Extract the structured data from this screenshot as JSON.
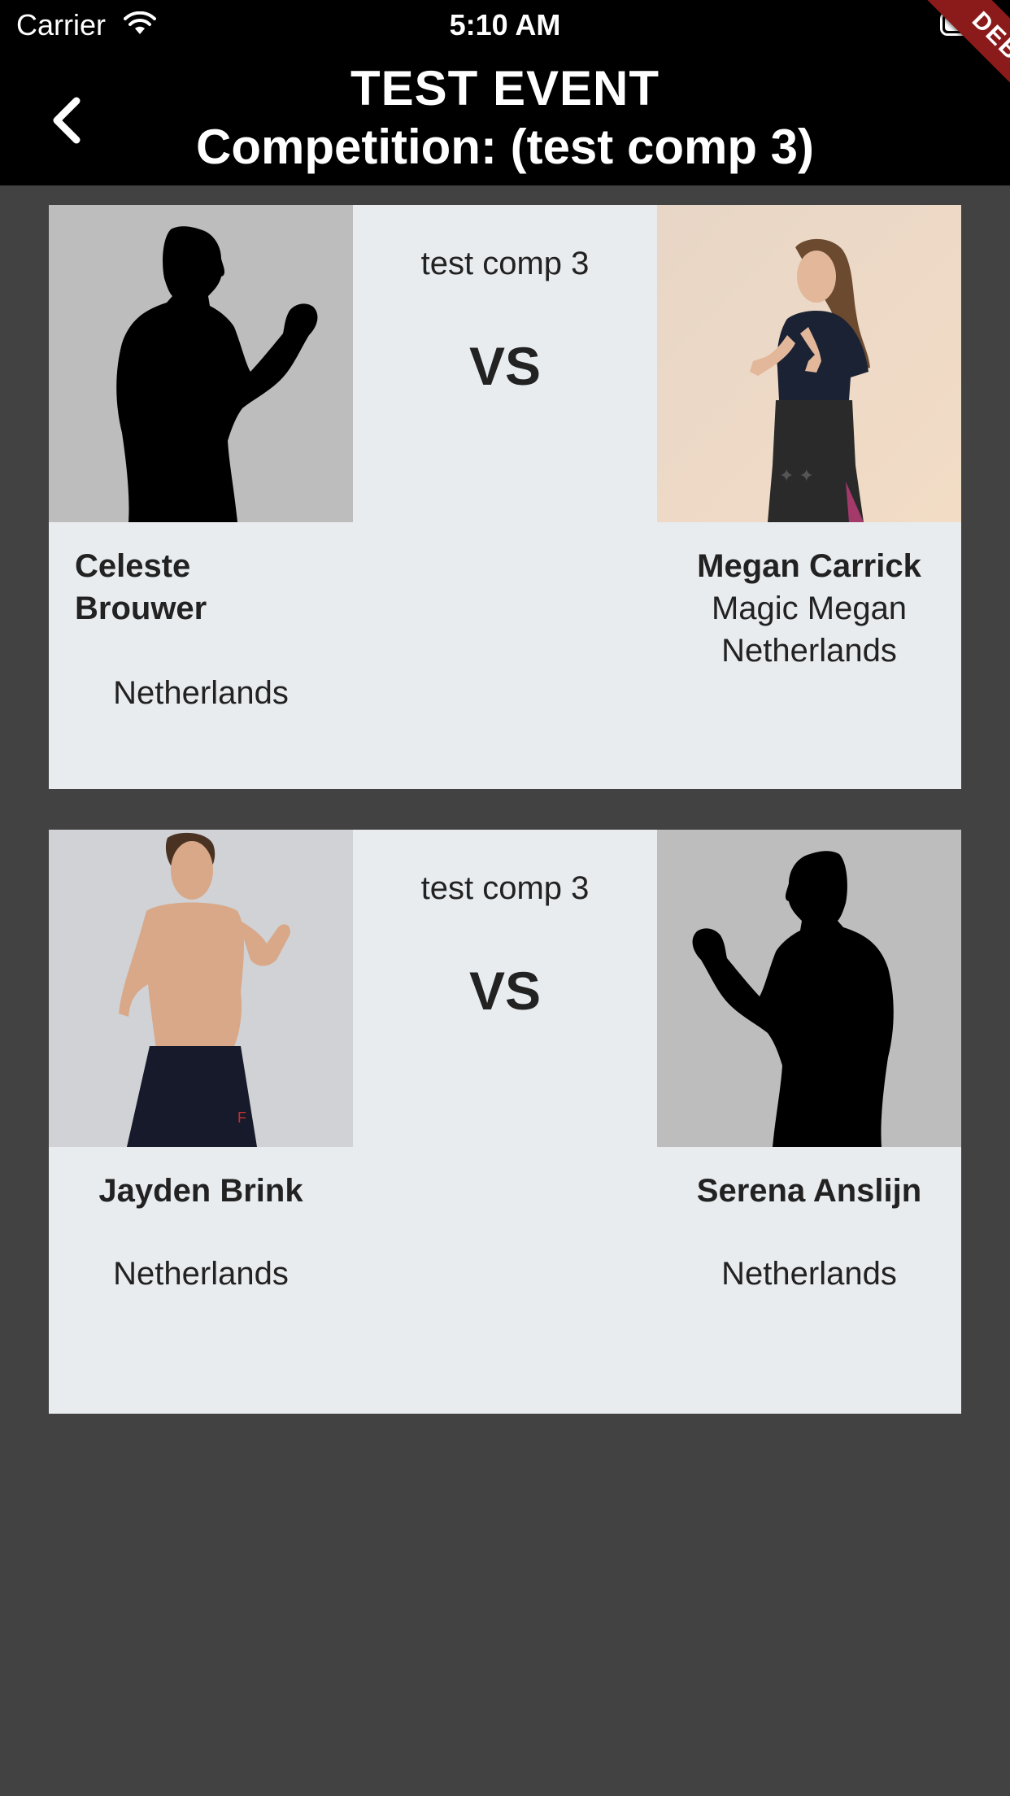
{
  "status_bar": {
    "carrier": "Carrier",
    "time": "5:10 AM"
  },
  "app_bar": {
    "title_line1": "TEST EVENT",
    "title_line2": "Competition: (test comp 3)",
    "debug_badge": "DEBUG"
  },
  "matches": [
    {
      "competition": "test comp 3",
      "vs": "VS",
      "left": {
        "name_line1": "Celeste",
        "name_line2": "Brouwer",
        "country": "Netherlands"
      },
      "right": {
        "name": "Megan Carrick",
        "nickname": "Magic Megan",
        "country": "Netherlands"
      }
    },
    {
      "competition": "test comp 3",
      "vs": "VS",
      "left": {
        "name": "Jayden Brink",
        "country": "Netherlands"
      },
      "right": {
        "name": "Serena Anslijn",
        "country": "Netherlands"
      }
    }
  ]
}
